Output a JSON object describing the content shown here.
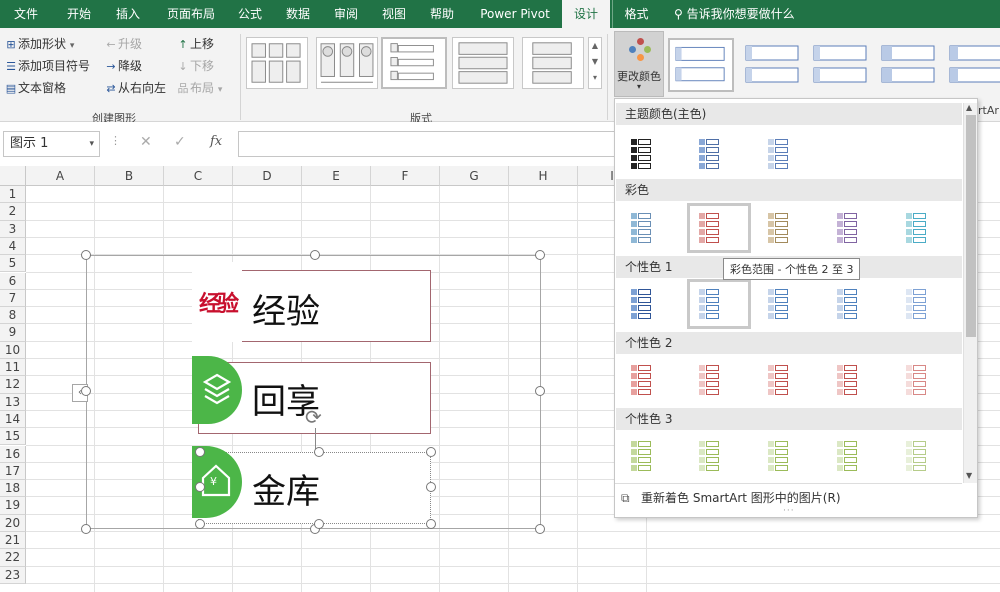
{
  "ribbon_tabs": [
    "文件",
    "开始",
    "插入",
    "页面布局",
    "公式",
    "数据",
    "审阅",
    "视图",
    "帮助",
    "Power Pivot",
    "设计",
    "格式"
  ],
  "active_tab": "设计",
  "tell_me": "告诉我你想要做什么",
  "create_graphic": {
    "add_shape": "添加形状",
    "add_bullet": "添加项目符号",
    "text_pane": "文本窗格",
    "promote": "升级",
    "demote": "降级",
    "right_to_left": "从右向左",
    "move_up": "上移",
    "move_down": "下移",
    "layout": "布局",
    "group_label": "创建图形"
  },
  "layouts_label": "版式",
  "change_colors": "更改颜色",
  "smartart_partial": "rtAr",
  "name_box": "图示 1",
  "formula_buttons": {
    "cancel": "✕",
    "enter": "✓",
    "fx": "fx"
  },
  "columns": [
    "A",
    "B",
    "C",
    "D",
    "E",
    "F",
    "G",
    "H",
    "I"
  ],
  "rows": [
    "1",
    "2",
    "3",
    "4",
    "5",
    "6",
    "7",
    "8",
    "9",
    "10",
    "11",
    "12",
    "13",
    "14",
    "15",
    "16",
    "17",
    "18",
    "19",
    "20",
    "21",
    "22",
    "23"
  ],
  "smartart": {
    "items": [
      {
        "text": "经验",
        "icon_text": "经验"
      },
      {
        "text": "回享",
        "icon_text": ""
      },
      {
        "text": "金库",
        "icon_text": "¥"
      }
    ]
  },
  "color_panel": {
    "sections": [
      "主题颜色(主色)",
      "彩色",
      "个性色 1",
      "个性色 2",
      "个性色 3"
    ],
    "tooltip": "彩色范围 - 个性色 2 至 3",
    "recolor": "重新着色 SmartArt 图形中的图片(R)"
  },
  "colors": {
    "excel_green": "#217346",
    "accent1": "#4f81bd",
    "accent2": "#c0504d",
    "accent3": "#9bbb59",
    "accent5": "#4bacc6",
    "accent4": "#8064a2",
    "icon_green": "#4cb648"
  }
}
